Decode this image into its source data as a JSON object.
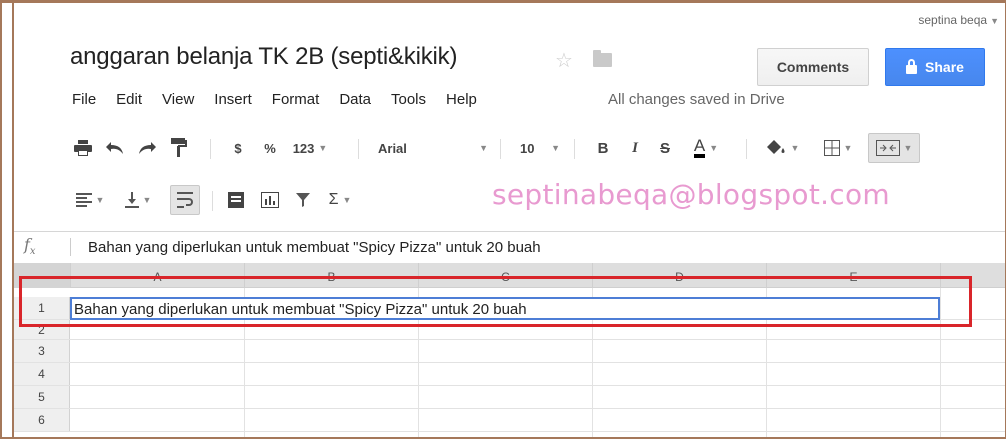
{
  "header": {
    "user_name": "septina beqa",
    "doc_title": "anggaran belanja TK 2B (septi&kikik)",
    "comments_label": "Comments",
    "share_label": "Share",
    "saved_status": "All changes saved in Drive"
  },
  "menu": [
    "File",
    "Edit",
    "View",
    "Insert",
    "Format",
    "Data",
    "Tools",
    "Help"
  ],
  "toolbar": {
    "currency": "$",
    "percent": "%",
    "number_format": "123",
    "font_name": "Arial",
    "font_size": "10",
    "bold": "B",
    "italic": "I",
    "strike": "S",
    "text_color": "A",
    "sum": "Σ"
  },
  "watermark": "septinabeqa@blogspot.com",
  "formula_bar": {
    "label": "fx",
    "content": "Bahan yang diperlukan untuk membuat \"Spicy Pizza\" untuk 20 buah"
  },
  "sheet": {
    "columns": [
      "A",
      "B",
      "C",
      "D",
      "E"
    ],
    "rows": [
      "1",
      "2",
      "3",
      "4",
      "5",
      "6"
    ],
    "a1": "Bahan yang diperlukan untuk membuat \"Spicy Pizza\" untuk 20 buah"
  },
  "colors": {
    "share": "#4d90fe",
    "highlight": "#d9252a",
    "selection": "#4d7ed6",
    "watermark": "#e89ad0"
  }
}
